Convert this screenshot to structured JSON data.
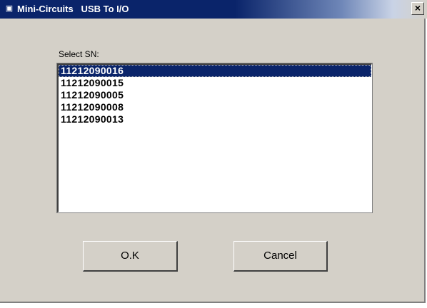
{
  "window": {
    "title": "Mini-Circuits   USB To I/O",
    "close_label": "×"
  },
  "icons": {
    "app": "app-icon",
    "close": "close-icon"
  },
  "form": {
    "select_label": "Select SN:",
    "serial_numbers": [
      "11212090016",
      "11212090015",
      "11212090005",
      "11212090008",
      "11212090013"
    ],
    "selected_index": 0
  },
  "buttons": {
    "ok_label": "O.K",
    "cancel_label": "Cancel"
  },
  "colors": {
    "title_bar": "#0a246a",
    "selection": "#0a246a",
    "dialog_face": "#d4d0c8"
  }
}
